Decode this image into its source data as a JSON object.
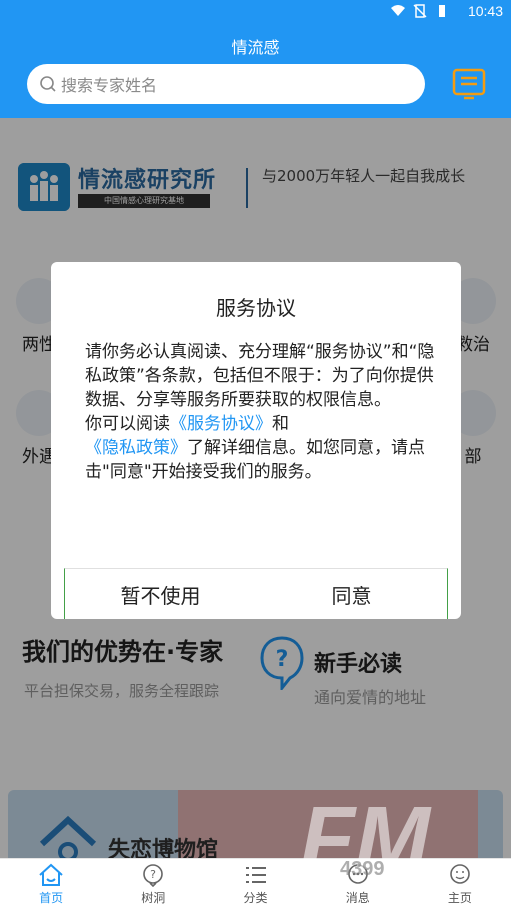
{
  "status_bar": {
    "time": "10:43",
    "icons": [
      "wifi-icon",
      "sim-off-icon",
      "battery-icon"
    ]
  },
  "header": {
    "title": "情流感"
  },
  "search": {
    "placeholder": "搜索专家姓名"
  },
  "banner": {
    "brand": "情流感研究所",
    "brand_sub": "中国情感心理研究基地",
    "slogan": "与2000万年轻人一起自我成长"
  },
  "grid": [
    {
      "label": "两性"
    },
    {
      "label": "救治"
    },
    {
      "label": "外遇"
    },
    {
      "label": "部"
    }
  ],
  "advantage": {
    "title": "我们的优势在·专家",
    "subtitle": "平台担保交易，服务全程跟踪"
  },
  "newbie": {
    "title": "新手必读",
    "subtitle": "通向爱情的地址"
  },
  "museum": {
    "title": "失恋博物馆"
  },
  "dialog": {
    "title": "服务协议",
    "para1": "请你务必认真阅读、充分理解“服务协议”和“隐私政策”各条款，包括但不限于：为了向你提供数据、分享等服务所要获取的权限信息。",
    "p2_a": "你可以阅读",
    "p2_link1": "《服务协议》",
    "p2_b": "和",
    "p2_link2": "《隐私政策》",
    "p2_c": "了解详细信息。如您同意，请点击\"同意\"开始接受我们的服务。",
    "decline": "暂不使用",
    "agree": "同意"
  },
  "bottom_nav": [
    {
      "label": "首页",
      "icon": "home-icon",
      "active": true
    },
    {
      "label": "树洞",
      "icon": "question-bubble-icon",
      "active": false
    },
    {
      "label": "分类",
      "icon": "list-icon",
      "active": false
    },
    {
      "label": "消息",
      "icon": "message-icon",
      "active": false
    },
    {
      "label": "主页",
      "icon": "smiley-icon",
      "active": false
    }
  ],
  "watermark": {
    "text": "FM",
    "number": "4399"
  },
  "colors": {
    "primary": "#2196f3",
    "accent_orange": "#f39c12",
    "dialog_border": "#43a047"
  }
}
